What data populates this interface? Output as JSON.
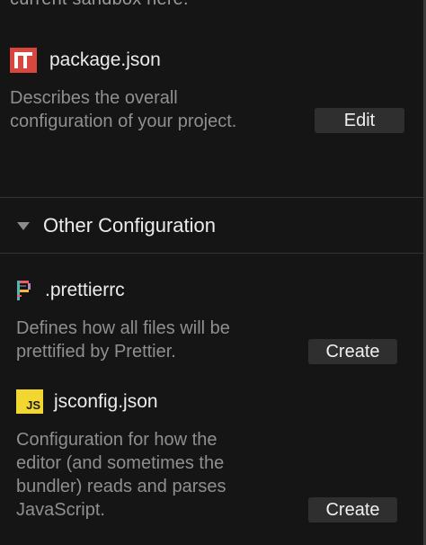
{
  "top": {
    "clipped_text": "current sandbox here."
  },
  "files": [
    {
      "icon": "npm-icon",
      "name": "package.json",
      "description_lines": [
        "Describes the overall",
        "configuration of your project."
      ],
      "action": "Edit"
    }
  ],
  "section": {
    "title": "Other Configuration",
    "expanded": true
  },
  "other_files": [
    {
      "icon": "prettier-icon",
      "name": ".prettierrc",
      "description_lines": [
        "Defines how all files will be",
        "prettified by Prettier."
      ],
      "action": "Create"
    },
    {
      "icon": "js-icon",
      "icon_text": "JS",
      "name": "jsconfig.json",
      "description_lines": [
        "Configuration for how the",
        "editor (and sometimes the",
        "bundler) reads and parses",
        "JavaScript."
      ],
      "action": "Create"
    }
  ],
  "colors": {
    "background": "#151515",
    "npm_red": "#d8473f",
    "js_yellow": "#f1d730",
    "button_bg": "#2f2f2f"
  }
}
